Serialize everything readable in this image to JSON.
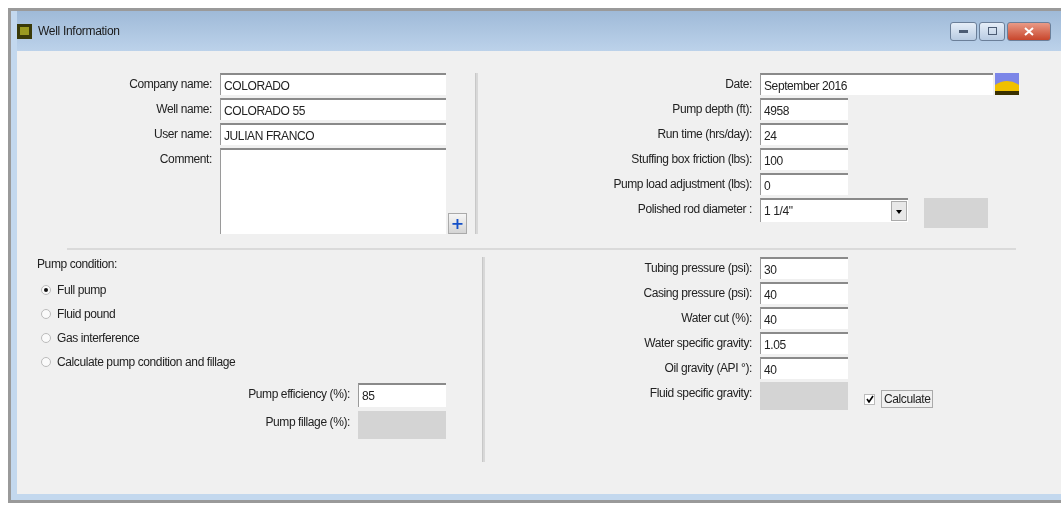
{
  "window": {
    "title": "Well Information"
  },
  "identity_fields": [
    {
      "label": "Company name:",
      "value": "COLORADO"
    },
    {
      "label": "Well name:",
      "value": "COLORADO 55"
    },
    {
      "label": "User name:",
      "value": "JULIAN FRANCO"
    }
  ],
  "comment": {
    "label": "Comment:",
    "button": "+"
  },
  "date": {
    "label": "Date:",
    "value": "September 2016"
  },
  "well_fields": [
    {
      "label": "Pump depth (ft):",
      "value": "4958"
    },
    {
      "label": "Run time (hrs/day):",
      "value": "24"
    },
    {
      "label": "Stuffing box friction (lbs):",
      "value": "100"
    },
    {
      "label": "Pump load adjustment (lbs):",
      "value": "0"
    }
  ],
  "polished_rod": {
    "label": "Polished rod diameter :",
    "value": "1 1/4\""
  },
  "pump_condition": {
    "label": "Pump condition:",
    "options": [
      {
        "label": "Full pump",
        "selected": true
      },
      {
        "label": "Fluid pound",
        "selected": false
      },
      {
        "label": "Gas interference",
        "selected": false
      },
      {
        "label": "Calculate pump condition and fillage",
        "selected": false
      }
    ]
  },
  "pump_fields": [
    {
      "label": "Pump efficiency (%):",
      "value": "85",
      "disabled": false
    },
    {
      "label": "Pump fillage (%):",
      "disabled": true
    }
  ],
  "fluid_fields": [
    {
      "label": "Tubing pressure (psi):",
      "value": "30",
      "disabled": false
    },
    {
      "label": "Casing pressure (psi):",
      "value": "40",
      "disabled": false
    },
    {
      "label": "Water cut (%):",
      "value": "40",
      "disabled": false
    },
    {
      "label": "Water specific gravity:",
      "value": "1.05",
      "disabled": false
    },
    {
      "label": "Oil gravity (API °):",
      "value": "40",
      "disabled": false
    },
    {
      "label": "Fluid specific gravity:",
      "disabled": true
    }
  ],
  "calculate": {
    "label": "Calculate",
    "checked": true
  }
}
